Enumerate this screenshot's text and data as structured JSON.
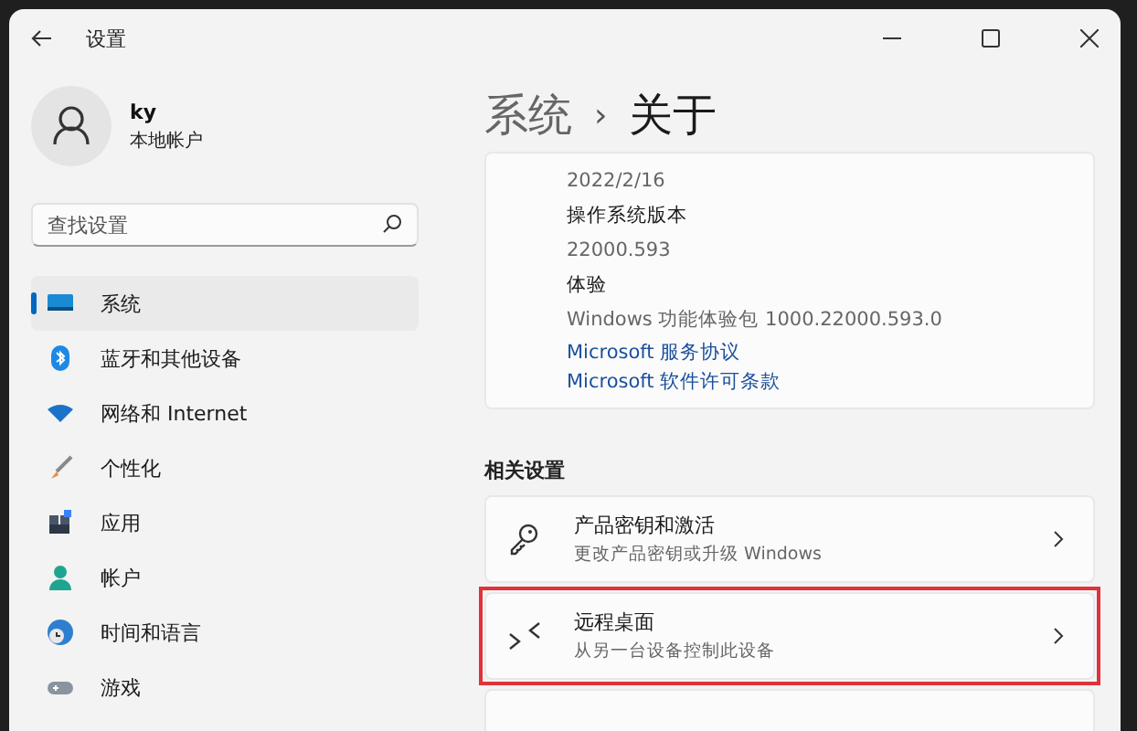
{
  "window": {
    "title": "设置"
  },
  "account": {
    "name": "ky",
    "type": "本地帐户"
  },
  "search": {
    "placeholder": "查找设置"
  },
  "nav": [
    {
      "kind": "display",
      "label": "系统",
      "selected": true
    },
    {
      "kind": "bluetooth",
      "label": "蓝牙和其他设备",
      "selected": false
    },
    {
      "kind": "wifi",
      "label": "网络和 Internet",
      "selected": false
    },
    {
      "kind": "brush",
      "label": "个性化",
      "selected": false
    },
    {
      "kind": "apps",
      "label": "应用",
      "selected": false
    },
    {
      "kind": "person",
      "label": "帐户",
      "selected": false
    },
    {
      "kind": "clock",
      "label": "时间和语言",
      "selected": false
    },
    {
      "kind": "gamepad",
      "label": "游戏",
      "selected": false
    }
  ],
  "breadcrumb": {
    "parent": "系统",
    "separator": "›",
    "current": "关于"
  },
  "info_rows": [
    {
      "kind": "value",
      "text": "2022/2/16"
    },
    {
      "kind": "label",
      "text": "操作系统版本"
    },
    {
      "kind": "value",
      "text": "22000.593"
    },
    {
      "kind": "label",
      "text": "体验"
    },
    {
      "kind": "value",
      "text": "Windows 功能体验包 1000.22000.593.0"
    },
    {
      "kind": "link",
      "text": "Microsoft 服务协议"
    },
    {
      "kind": "link",
      "text": "Microsoft 软件许可条款"
    }
  ],
  "related": {
    "heading": "相关设置",
    "items": [
      {
        "kind": "key",
        "title": "产品密钥和激活",
        "subtitle": "更改产品密钥或升级 Windows",
        "highlighted": false
      },
      {
        "kind": "remote",
        "title": "远程桌面",
        "subtitle": "从另一台设备控制此设备",
        "highlighted": true
      },
      {
        "kind": "blank",
        "highlighted": false
      }
    ]
  }
}
